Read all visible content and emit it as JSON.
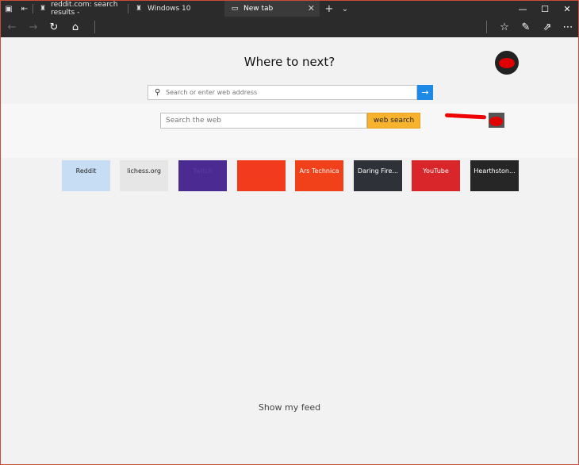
{
  "tabs": [
    {
      "title": "reddit.com: search results -",
      "active": false,
      "icon": "reddit-favicon"
    },
    {
      "title": "Windows 10",
      "active": false,
      "icon": "reddit-favicon"
    },
    {
      "title": "New tab",
      "active": true,
      "icon": "new-tab-icon"
    }
  ],
  "address_bar": {
    "placeholder": "Search or enter web address"
  },
  "heading": "Where to next?",
  "web_search": {
    "placeholder": "Search the web",
    "button_label": "web search"
  },
  "top_sites": [
    {
      "label": "Reddit",
      "bg": "#c7ddf3",
      "fg": "#222222"
    },
    {
      "label": "lichess.org",
      "bg": "#e6e6e6",
      "fg": "#222222"
    },
    {
      "label": "Twitch",
      "bg": "#4b2a91",
      "fg": "#5d3ca8"
    },
    {
      "label": "Pocket Casts",
      "bg": "#f23a1d",
      "fg": "#f03d20"
    },
    {
      "label": "Ars Technica",
      "bg": "#f0411a",
      "fg": "#ffffff"
    },
    {
      "label": "Daring Fire...",
      "bg": "#2e3137",
      "fg": "#ffffff"
    },
    {
      "label": "YouTube",
      "bg": "#d9262b",
      "fg": "#ffffff"
    },
    {
      "label": "Hearthston...",
      "bg": "#262626",
      "fg": "#ffffff"
    }
  ],
  "feed_label": "Show my feed",
  "colors": {
    "accent": "#1f8ae6",
    "search_button": "#f7b32d",
    "chrome": "#2b2b2b"
  }
}
